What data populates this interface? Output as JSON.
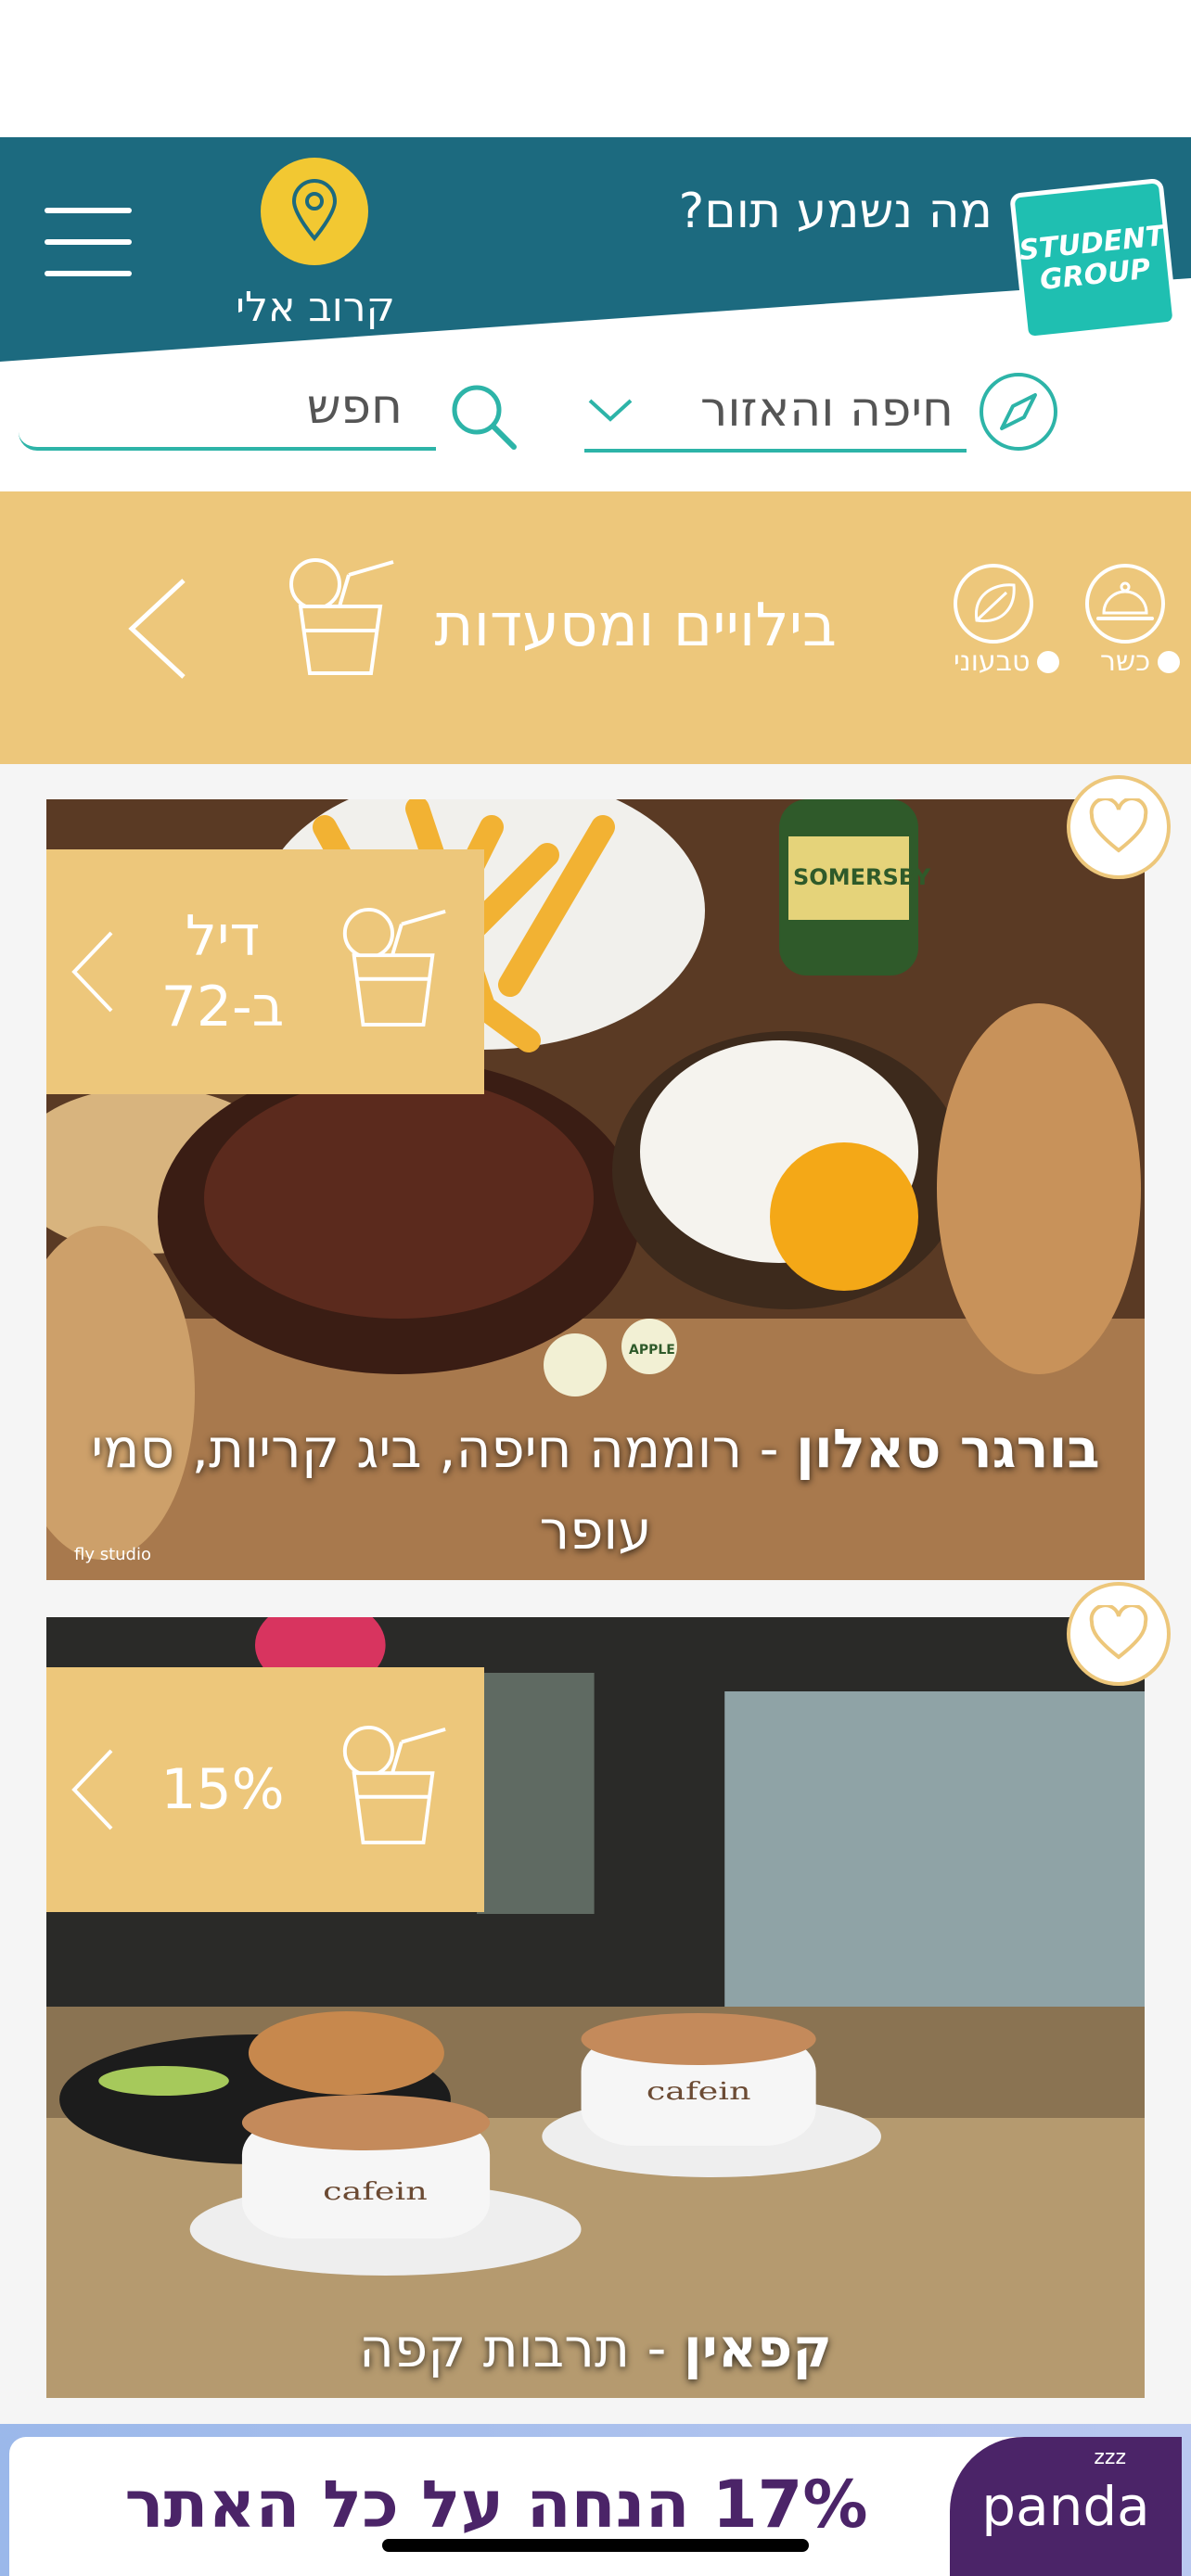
{
  "header": {
    "tagline": "מה נשמע תום?",
    "near_me_label": "קרוב אלי",
    "logo_line1": "STUDENT",
    "logo_line2": "GROUP",
    "menu_icon": "hamburger-menu-icon",
    "pin_icon": "location-pin-icon"
  },
  "search": {
    "placeholder": "חפש",
    "region_value": "חיפה והאזור",
    "icons": [
      "search-icon",
      "compass-icon",
      "chevron-down-icon"
    ]
  },
  "category": {
    "title": "בילויים ומסעדות",
    "filters": [
      {
        "label": "כשר",
        "icon": "cloche-icon"
      },
      {
        "label": "טבעוני",
        "icon": "leaf-icon"
      }
    ]
  },
  "deals": [
    {
      "deal_line1": "דיל",
      "deal_line2": "ב-72",
      "name": "בורגר סאלון",
      "location": " - רוממה חיפה, ביג קריות, סמי עופר",
      "image_text_1": "fly studio",
      "image_text_2": "SOMERSBY",
      "image_text_3": "APPLE"
    },
    {
      "deal_line1": "15%",
      "deal_line2": "",
      "name": "קפאין",
      "location": " - תרבות קפה",
      "cup_logo": "cafein"
    }
  ],
  "ad": {
    "text": "17% הנחה על כל האתר",
    "brand": "panda",
    "brand_mark": "zzz"
  },
  "colors": {
    "header_teal": "#1c6a7f",
    "accent_yellow": "#f2c832",
    "band_gold": "#edc77b",
    "line_teal": "#2db4a8",
    "ad_purple": "#4b2468"
  }
}
